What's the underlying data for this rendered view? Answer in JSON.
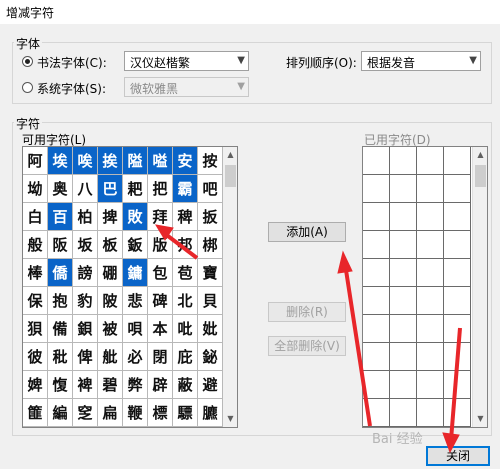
{
  "window": {
    "title": "增减字符"
  },
  "font_group": {
    "label": "字体",
    "calligraphy_label": "书法字体(C):",
    "calligraphy_value": "汉仪赵楷繁",
    "system_label": "系统字体(S):",
    "system_value": "微软雅黑",
    "sort_label": "排列顺序(O):",
    "sort_value": "根据发音"
  },
  "chars_group": {
    "label": "字符",
    "available_label": "可用字符(L)",
    "used_label": "已用字符(D)",
    "selected_count": 9,
    "rows": [
      [
        "阿",
        "埃",
        "唉",
        "挨",
        "隘",
        "嗌",
        "安",
        "按"
      ],
      [
        "坳",
        "奥",
        "八",
        "巴",
        "耙",
        "把",
        "霸",
        "吧"
      ],
      [
        "白",
        "百",
        "柏",
        "捭",
        "敗",
        "拜",
        "稗",
        "扳"
      ],
      [
        "般",
        "阪",
        "坂",
        "板",
        "鈑",
        "版",
        "邦",
        "梆"
      ],
      [
        "棒",
        "僑",
        "謗",
        "硼",
        "鏞",
        "包",
        "苞",
        "寶"
      ],
      [
        "保",
        "抱",
        "豹",
        "陂",
        "悲",
        "碑",
        "北",
        "貝"
      ],
      [
        "狽",
        "備",
        "鋇",
        "被",
        "唄",
        "本",
        "吡",
        "妣"
      ],
      [
        "彼",
        "秕",
        "俾",
        "舭",
        "必",
        "閉",
        "庇",
        "鉍"
      ],
      [
        "婢",
        "愎",
        "裨",
        "碧",
        "弊",
        "辟",
        "蔽",
        "避"
      ],
      [
        "篚",
        "編",
        "窆",
        "扁",
        "鞭",
        "標",
        "驃",
        "臕"
      ]
    ]
  },
  "buttons": {
    "add": "添加(A)",
    "delete": "删除(R)",
    "delete_all": "全部删除(V)",
    "close": "关闭"
  },
  "watermark": "Bai 经验",
  "colors": {
    "selection": "#0a64c8",
    "arrow": "#e8262a"
  },
  "icons": {
    "radio": "radio-icon",
    "dropdown": "chevron-down-icon",
    "scroll_up": "scroll-up-icon",
    "scroll_down": "scroll-down-icon"
  }
}
